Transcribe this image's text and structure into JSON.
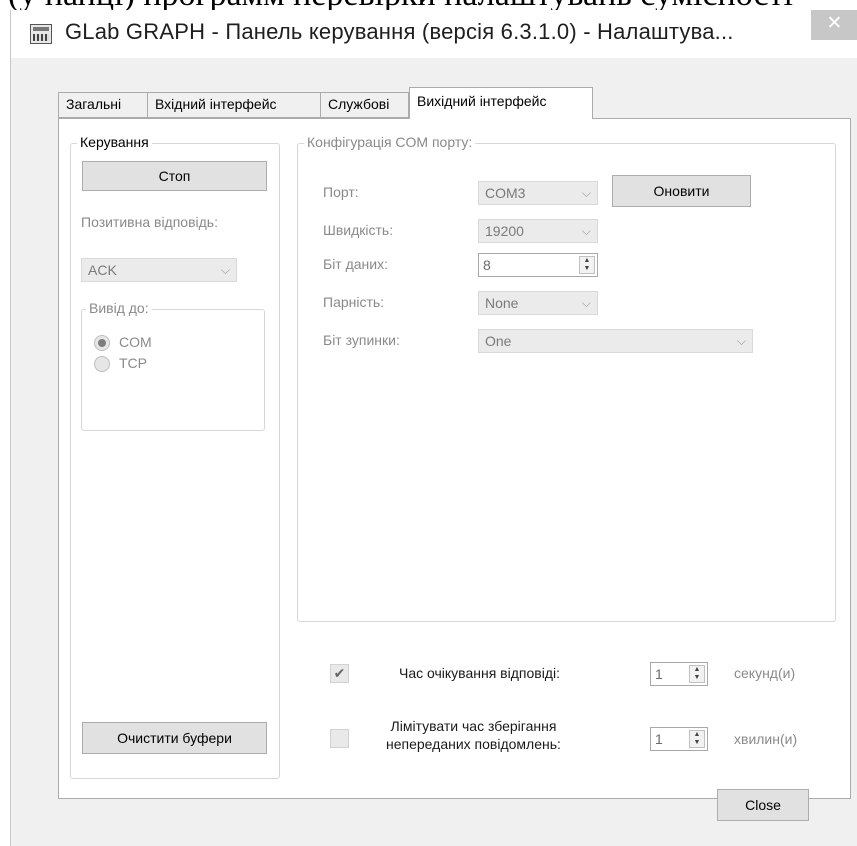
{
  "window": {
    "title": "GLab GRAPH - Панель керування (версія 6.3.1.0) - Налаштува...",
    "close_glyph": "✕"
  },
  "tabs": [
    {
      "label": "Загальні"
    },
    {
      "label": "Вхідний інтерфейс"
    },
    {
      "label": "Службові"
    },
    {
      "label": "Вихідний інтерфейс"
    }
  ],
  "control_group": {
    "legend": "Керування",
    "stop_button": "Стоп",
    "response_label": "Позитивна відповідь:",
    "response_value": "ACK",
    "output_legend": "Вивід до:",
    "options": [
      "COM",
      "TCP"
    ],
    "selected": "COM",
    "clear_button": "Очистити буфери"
  },
  "com_config": {
    "legend": "Конфігурація COM порту:",
    "port_label": "Порт:",
    "port_value": "COM3",
    "refresh_button": "Оновити",
    "speed_label": "Швидкість:",
    "speed_value": "19200",
    "data_bits_label": "Біт даних:",
    "data_bits_value": "8",
    "parity_label": "Парність:",
    "parity_value": "None",
    "stop_bits_label": "Біт зупинки:",
    "stop_bits_value": "One"
  },
  "timeouts": {
    "response_checked": true,
    "response_label": "Час очікування відповіді:",
    "response_value": "1",
    "response_unit": "секунд(и)",
    "limit_checked": false,
    "limit_label_line1": "Лімітувати час зберігання",
    "limit_label_line2": "непереданих повідомлень:",
    "limit_value": "1",
    "limit_unit": "хвилин(и)"
  },
  "footer": {
    "close_button": "Close"
  },
  "icons": {
    "checkmark": "✔",
    "combo_arrow": "⌵",
    "spin_up": "▲",
    "spin_down": "▼"
  },
  "colors": {
    "window_bg": "#f0f0f0",
    "panel_bg": "#ffffff",
    "disabled_text": "#8a8a8a",
    "button_bg": "#e1e1e1"
  }
}
